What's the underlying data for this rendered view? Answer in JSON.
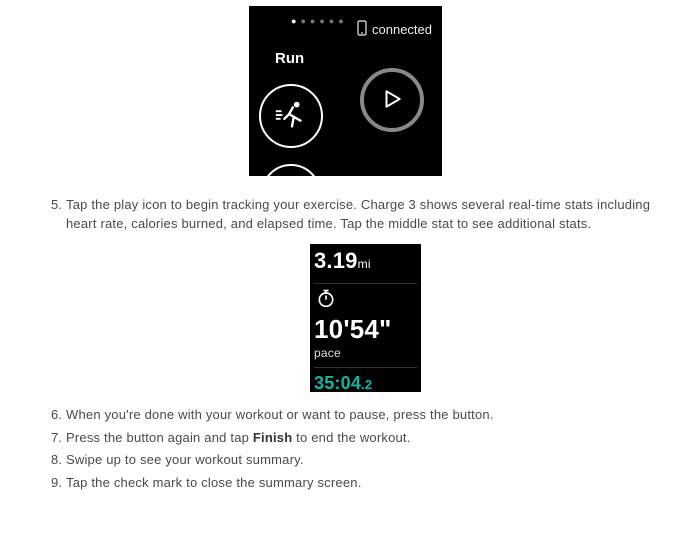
{
  "device1": {
    "status_text": "connected",
    "mode_label": "Run"
  },
  "steps": {
    "s5": "Tap the play icon to begin tracking your exercise. Charge 3 shows several real-time stats including heart rate, calories burned, and elapsed time. Tap the middle stat to see additional stats.",
    "s6": "When you're done with your workout or want to pause, press the button.",
    "s7_a": "Press the button again and tap ",
    "s7_b": "Finish",
    "s7_c": " to end the workout.",
    "s8": "Swipe up to see your workout summary.",
    "s9": "Tap the check mark to close the summary screen."
  },
  "device2": {
    "distance_value": "3.19",
    "distance_unit": "mi",
    "pace_value": "10'54\"",
    "pace_label": "pace",
    "elapsed_main": "35:04",
    "elapsed_tenths": ".2"
  }
}
